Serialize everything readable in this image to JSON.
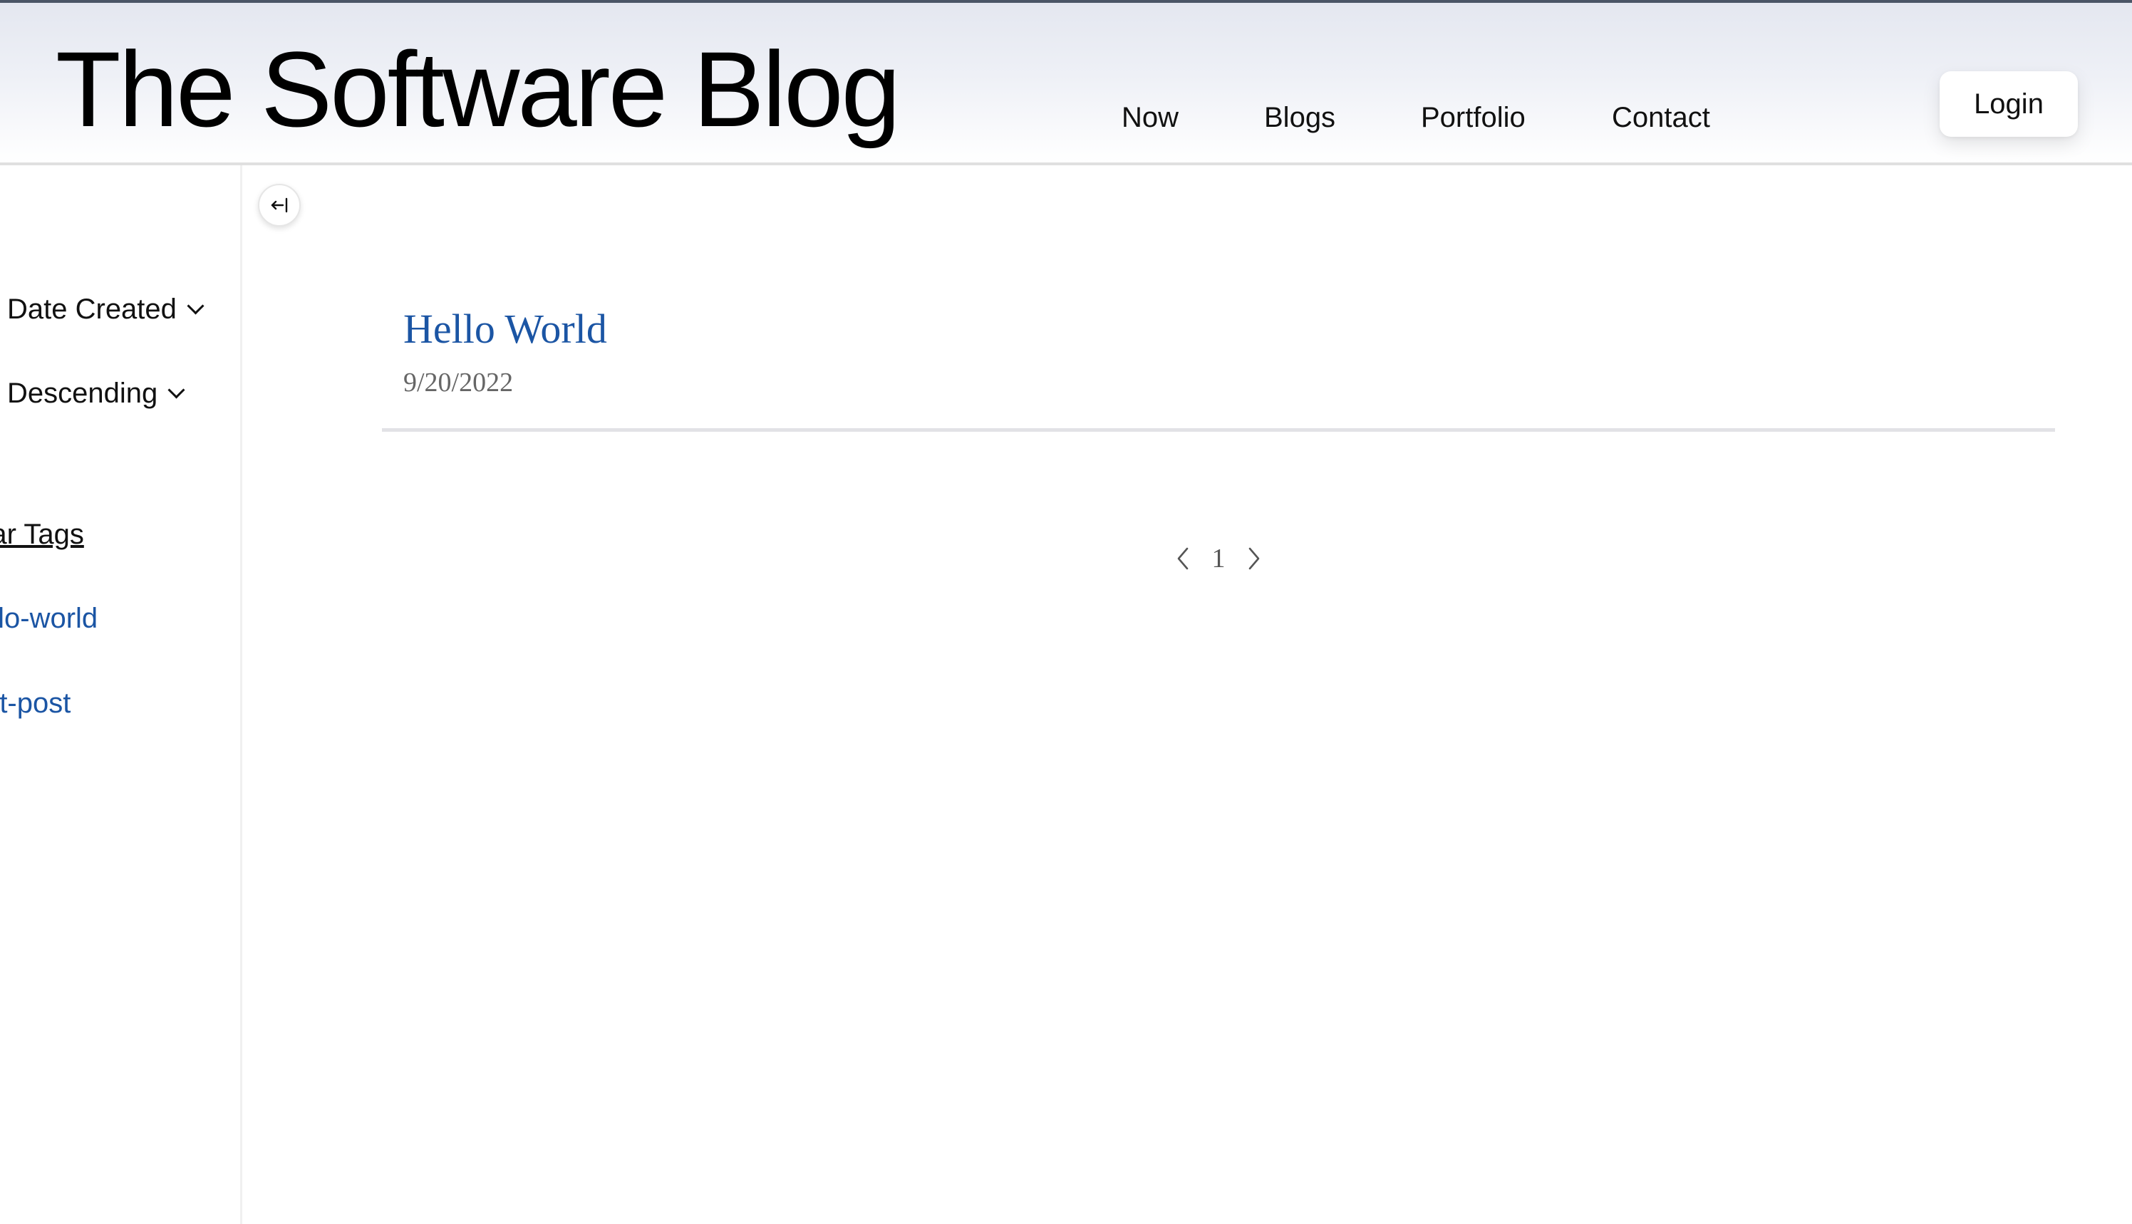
{
  "header": {
    "site_title": "The Software Blog",
    "nav": [
      {
        "label": "Now"
      },
      {
        "label": "Blogs"
      },
      {
        "label": "Portfolio"
      },
      {
        "label": "Contact"
      }
    ],
    "login_label": "Login"
  },
  "sidebar": {
    "sort_field": "Date Created",
    "sort_order": "Descending",
    "tags_heading": "pular Tags",
    "tags": [
      {
        "label": "ello-world"
      },
      {
        "label": "rst-post"
      }
    ],
    "collapse_icon": "collapse-left-icon"
  },
  "main": {
    "posts": [
      {
        "title": "Hello World",
        "date": "9/20/2022"
      }
    ],
    "pagination": {
      "current_page": "1"
    }
  },
  "colors": {
    "link": "#1b55a4",
    "date_text": "#666666",
    "divider": "#e2e2e6"
  }
}
